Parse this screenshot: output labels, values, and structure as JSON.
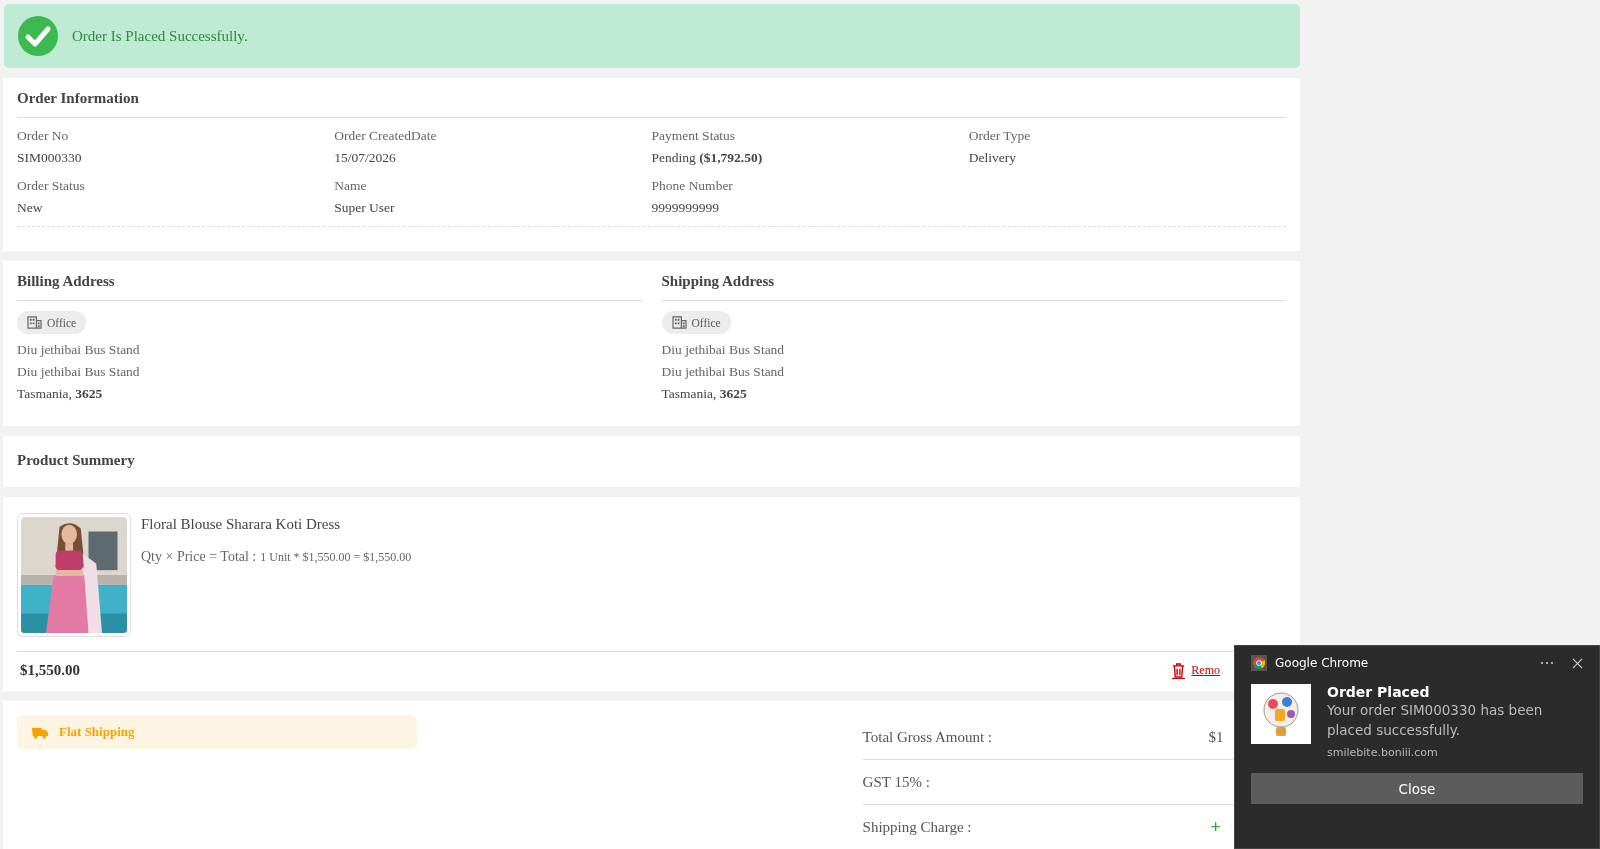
{
  "notice": {
    "text": "Order Is Placed Successfully."
  },
  "order_info": {
    "title": "Order Information",
    "fields": [
      {
        "label": "Order No",
        "value": "SIM000330"
      },
      {
        "label": "Order CreatedDate",
        "value": "15/07/2026"
      },
      {
        "label": "Payment Status",
        "value": "Pending  **($1,792.50)**"
      },
      {
        "label": "Order Type",
        "value": "Delivery"
      },
      {
        "label": "Order Status",
        "value": "New"
      },
      {
        "label": "Name",
        "value": "Super User"
      },
      {
        "label": "Phone Number",
        "value": "9999999999"
      }
    ]
  },
  "addresses": [
    {
      "title": "Billing Address",
      "tag": "Office",
      "lines": [
        "Diu jethibai Bus Stand",
        "Diu jethibai Bus Stand",
        "Tasmania, **3625**"
      ]
    },
    {
      "title": "Shipping Address",
      "tag": "Office",
      "lines": [
        "Diu jethibai Bus Stand",
        "Diu jethibai Bus Stand",
        "Tasmania, **3625**"
      ]
    }
  ],
  "product_summary": {
    "title": "Product Summery",
    "items": [
      {
        "kind": "picture",
        "name": "Floral Blouse Sharara Koti Dress",
        "formula_label": "Qty × Price = Total :",
        "formula": "1 Unit * $1,550.00 = $1,550.00",
        "total": "$1,550.00",
        "remove_label": "Remo"
      }
    ]
  },
  "shipping": {
    "method": "Flat Shipping"
  },
  "totals": [
    {
      "label": "Total Gross Amount :",
      "value": "$1"
    },
    {
      "label": "GST 15% :"
    },
    {
      "label": "Shipping Charge :",
      "value": "+",
      "color": "#33aa33"
    }
  ],
  "toast": {
    "app": "Google Chrome",
    "title": "Order Placed",
    "message": "Your order SIM000330 has been placed successfully.",
    "source": "smilebite.boniii.com",
    "button": "Close"
  }
}
